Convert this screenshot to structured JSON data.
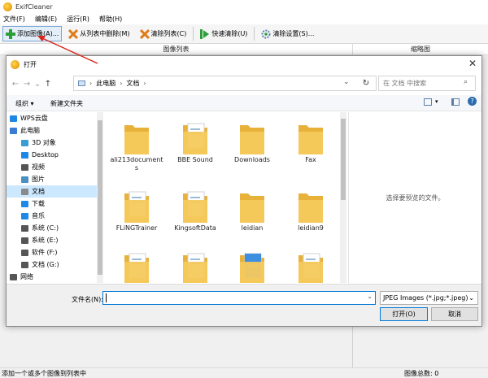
{
  "app": {
    "title": "ExifCleaner"
  },
  "menu": [
    "文件(F)",
    "编辑(E)",
    "运行(R)",
    "帮助(H)"
  ],
  "toolbar": {
    "add": "添加图像(A)...",
    "remove": "从列表中删除(M)",
    "clear": "清除列表(C)",
    "quick": "快速清除(U)",
    "settings": "清除设置(S)..."
  },
  "columns": {
    "image_list": "图像列表",
    "thumbnail": "缩略图"
  },
  "status": {
    "left": "添加一个或多个图像到列表中",
    "right": "图像总数: 0"
  },
  "dialog": {
    "title": "打开",
    "breadcrumb": [
      "此电脑",
      "文档"
    ],
    "search_placeholder": "在 文档 中搜索",
    "organize": "组织",
    "new_folder": "新建文件夹",
    "tree": [
      {
        "label": "WPS云盘",
        "icon": "cloud-icon",
        "color": "#1e88e5"
      },
      {
        "label": "此电脑",
        "icon": "computer-icon",
        "color": "#3a7bd5"
      },
      {
        "label": "3D 对象",
        "icon": "cube-icon",
        "color": "#3a9bd5"
      },
      {
        "label": "Desktop",
        "icon": "desktop-icon",
        "color": "#1e88e5"
      },
      {
        "label": "视频",
        "icon": "video-icon",
        "color": "#555555"
      },
      {
        "label": "图片",
        "icon": "picture-icon",
        "color": "#4a90c2"
      },
      {
        "label": "文档",
        "icon": "document-icon",
        "color": "#8a8a8a",
        "selected": true
      },
      {
        "label": "下载",
        "icon": "download-icon",
        "color": "#1e88e5"
      },
      {
        "label": "音乐",
        "icon": "music-icon",
        "color": "#1e88e5"
      },
      {
        "label": "系统 (C:)",
        "icon": "drive-icon",
        "color": "#555555"
      },
      {
        "label": "系统 (E:)",
        "icon": "drive-icon",
        "color": "#555555"
      },
      {
        "label": "软件 (F:)",
        "icon": "drive-icon",
        "color": "#555555"
      },
      {
        "label": "文档 (G:)",
        "icon": "drive-icon",
        "color": "#555555"
      },
      {
        "label": "网络",
        "icon": "network-icon",
        "color": "#555555"
      }
    ],
    "files": [
      {
        "label": "ali213documents"
      },
      {
        "label": "BBE Sound"
      },
      {
        "label": "Downloads"
      },
      {
        "label": "Fax"
      },
      {
        "label": "FLiNGTrainer"
      },
      {
        "label": "KingsoftData"
      },
      {
        "label": "leidian"
      },
      {
        "label": "leidian9"
      },
      {
        "label": ""
      },
      {
        "label": ""
      },
      {
        "label": ""
      },
      {
        "label": ""
      }
    ],
    "preview_text": "选择要预览的文件。",
    "filename_label": "文件名(N):",
    "filename_value": "",
    "filter": "JPEG Images (*.jpg;*.jpeg)",
    "open": "打开(O)",
    "cancel": "取消"
  },
  "colors": {
    "folder": "#f5c95c",
    "folder_dark": "#e8b23a",
    "accent": "#0078d7",
    "arrow": "#d9261c"
  }
}
